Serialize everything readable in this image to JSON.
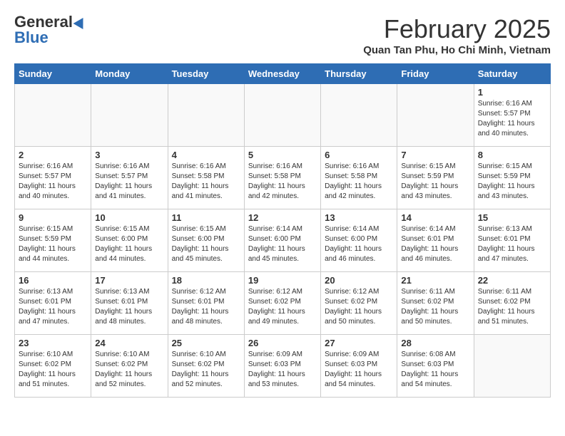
{
  "header": {
    "logo_general": "General",
    "logo_blue": "Blue",
    "month_title": "February 2025",
    "subtitle": "Quan Tan Phu, Ho Chi Minh, Vietnam"
  },
  "weekdays": [
    "Sunday",
    "Monday",
    "Tuesday",
    "Wednesday",
    "Thursday",
    "Friday",
    "Saturday"
  ],
  "weeks": [
    [
      {
        "day": "",
        "empty": true
      },
      {
        "day": "",
        "empty": true
      },
      {
        "day": "",
        "empty": true
      },
      {
        "day": "",
        "empty": true
      },
      {
        "day": "",
        "empty": true
      },
      {
        "day": "",
        "empty": true
      },
      {
        "day": "1",
        "sunrise": "6:16 AM",
        "sunset": "5:57 PM",
        "daylight": "11 hours and 40 minutes."
      }
    ],
    [
      {
        "day": "2",
        "sunrise": "6:16 AM",
        "sunset": "5:57 PM",
        "daylight": "11 hours and 40 minutes."
      },
      {
        "day": "3",
        "sunrise": "6:16 AM",
        "sunset": "5:57 PM",
        "daylight": "11 hours and 41 minutes."
      },
      {
        "day": "4",
        "sunrise": "6:16 AM",
        "sunset": "5:58 PM",
        "daylight": "11 hours and 41 minutes."
      },
      {
        "day": "5",
        "sunrise": "6:16 AM",
        "sunset": "5:58 PM",
        "daylight": "11 hours and 42 minutes."
      },
      {
        "day": "6",
        "sunrise": "6:16 AM",
        "sunset": "5:58 PM",
        "daylight": "11 hours and 42 minutes."
      },
      {
        "day": "7",
        "sunrise": "6:15 AM",
        "sunset": "5:59 PM",
        "daylight": "11 hours and 43 minutes."
      },
      {
        "day": "8",
        "sunrise": "6:15 AM",
        "sunset": "5:59 PM",
        "daylight": "11 hours and 43 minutes."
      }
    ],
    [
      {
        "day": "9",
        "sunrise": "6:15 AM",
        "sunset": "5:59 PM",
        "daylight": "11 hours and 44 minutes."
      },
      {
        "day": "10",
        "sunrise": "6:15 AM",
        "sunset": "6:00 PM",
        "daylight": "11 hours and 44 minutes."
      },
      {
        "day": "11",
        "sunrise": "6:15 AM",
        "sunset": "6:00 PM",
        "daylight": "11 hours and 45 minutes."
      },
      {
        "day": "12",
        "sunrise": "6:14 AM",
        "sunset": "6:00 PM",
        "daylight": "11 hours and 45 minutes."
      },
      {
        "day": "13",
        "sunrise": "6:14 AM",
        "sunset": "6:00 PM",
        "daylight": "11 hours and 46 minutes."
      },
      {
        "day": "14",
        "sunrise": "6:14 AM",
        "sunset": "6:01 PM",
        "daylight": "11 hours and 46 minutes."
      },
      {
        "day": "15",
        "sunrise": "6:13 AM",
        "sunset": "6:01 PM",
        "daylight": "11 hours and 47 minutes."
      }
    ],
    [
      {
        "day": "16",
        "sunrise": "6:13 AM",
        "sunset": "6:01 PM",
        "daylight": "11 hours and 47 minutes."
      },
      {
        "day": "17",
        "sunrise": "6:13 AM",
        "sunset": "6:01 PM",
        "daylight": "11 hours and 48 minutes."
      },
      {
        "day": "18",
        "sunrise": "6:12 AM",
        "sunset": "6:01 PM",
        "daylight": "11 hours and 48 minutes."
      },
      {
        "day": "19",
        "sunrise": "6:12 AM",
        "sunset": "6:02 PM",
        "daylight": "11 hours and 49 minutes."
      },
      {
        "day": "20",
        "sunrise": "6:12 AM",
        "sunset": "6:02 PM",
        "daylight": "11 hours and 50 minutes."
      },
      {
        "day": "21",
        "sunrise": "6:11 AM",
        "sunset": "6:02 PM",
        "daylight": "11 hours and 50 minutes."
      },
      {
        "day": "22",
        "sunrise": "6:11 AM",
        "sunset": "6:02 PM",
        "daylight": "11 hours and 51 minutes."
      }
    ],
    [
      {
        "day": "23",
        "sunrise": "6:10 AM",
        "sunset": "6:02 PM",
        "daylight": "11 hours and 51 minutes."
      },
      {
        "day": "24",
        "sunrise": "6:10 AM",
        "sunset": "6:02 PM",
        "daylight": "11 hours and 52 minutes."
      },
      {
        "day": "25",
        "sunrise": "6:10 AM",
        "sunset": "6:02 PM",
        "daylight": "11 hours and 52 minutes."
      },
      {
        "day": "26",
        "sunrise": "6:09 AM",
        "sunset": "6:03 PM",
        "daylight": "11 hours and 53 minutes."
      },
      {
        "day": "27",
        "sunrise": "6:09 AM",
        "sunset": "6:03 PM",
        "daylight": "11 hours and 54 minutes."
      },
      {
        "day": "28",
        "sunrise": "6:08 AM",
        "sunset": "6:03 PM",
        "daylight": "11 hours and 54 minutes."
      },
      {
        "day": "",
        "empty": true
      }
    ]
  ],
  "labels": {
    "sunrise": "Sunrise:",
    "sunset": "Sunset:",
    "daylight": "Daylight:"
  }
}
